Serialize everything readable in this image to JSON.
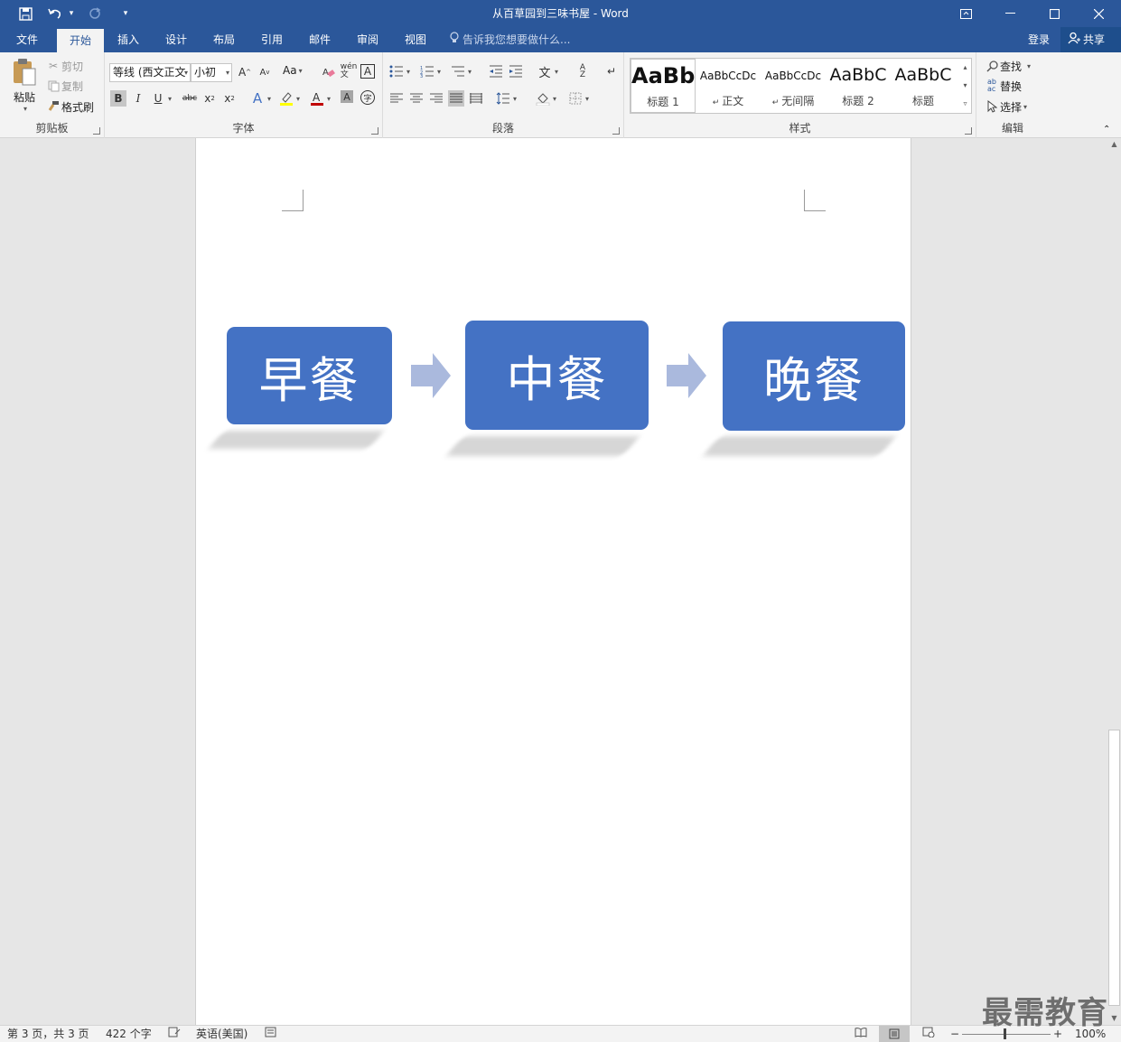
{
  "window": {
    "title": "从百草园到三味书屋 - Word",
    "qat": {
      "save_icon": "save-icon",
      "undo_icon": "undo-icon",
      "redo_icon": "redo-icon",
      "customize_icon": "customize-qat-icon"
    },
    "controls": {
      "ribbon_display": "ribbon-display-options-icon",
      "minimize": "minimize-icon",
      "maximize": "maximize-icon",
      "close": "close-icon"
    }
  },
  "tabs": {
    "file": "文件",
    "home": "开始",
    "insert": "插入",
    "design": "设计",
    "layout": "布局",
    "references": "引用",
    "mailings": "邮件",
    "review": "审阅",
    "view": "视图",
    "tellme": "告诉我您想要做什么...",
    "login": "登录",
    "share": "共享"
  },
  "ribbon": {
    "clipboard": {
      "label": "剪贴板",
      "paste": "粘贴",
      "cut": "剪切",
      "copy": "复制",
      "format_painter": "格式刷"
    },
    "font": {
      "label": "字体",
      "font_name": "等线 (西文正文",
      "font_size": "小初",
      "aa": "Aa"
    },
    "paragraph": {
      "label": "段落"
    },
    "styles": {
      "label": "样式",
      "items": [
        {
          "sample": "AaBb",
          "name": "标题 1"
        },
        {
          "sample": "AaBbCcDc",
          "name": "正文"
        },
        {
          "sample": "AaBbCcDc",
          "name": "无间隔"
        },
        {
          "sample": "AaBbC",
          "name": "标题 2"
        },
        {
          "sample": "AaBbC",
          "name": "标题"
        }
      ]
    },
    "editing": {
      "label": "编辑",
      "find": "查找",
      "replace": "替换",
      "select": "选择"
    }
  },
  "document": {
    "flow": [
      {
        "label": "早餐"
      },
      {
        "label": "中餐"
      },
      {
        "label": "晚餐"
      }
    ],
    "box_color": "#4472c4",
    "arrow_color": "#aab9dd"
  },
  "status": {
    "page": "第 3 页，共 3 页",
    "words": "422 个字",
    "language": "英语(美国)",
    "zoom": "100%"
  },
  "watermark": "最需教育"
}
